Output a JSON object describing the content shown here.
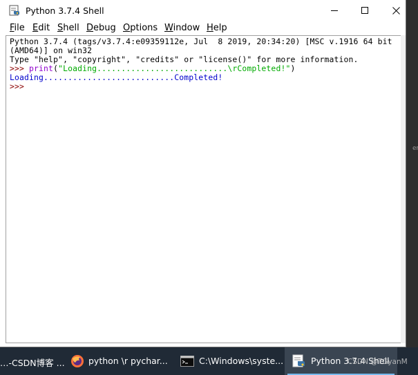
{
  "window": {
    "title": "Python 3.7.4 Shell",
    "icon": "python-idle-icon",
    "controls": [
      "minimize-icon",
      "maximize-icon",
      "close-icon"
    ]
  },
  "menu": {
    "items": [
      {
        "label": "File",
        "underline": "F",
        "rest": "ile"
      },
      {
        "label": "Edit",
        "underline": "E",
        "rest": "dit"
      },
      {
        "label": "Shell",
        "underline": "S",
        "rest": "hell"
      },
      {
        "label": "Debug",
        "underline": "D",
        "rest": "ebug"
      },
      {
        "label": "Options",
        "underline": "O",
        "rest": "ptions"
      },
      {
        "label": "Window",
        "underline": "W",
        "rest": "indow"
      },
      {
        "label": "Help",
        "underline": "H",
        "rest": "elp"
      }
    ]
  },
  "shell": {
    "banner_line1": "Python 3.7.4 (tags/v3.7.4:e09359112e, Jul  8 2019, 20:34:20) [MSC v.1916 64 bit",
    "banner_line2": "(AMD64)] on win32",
    "banner_line3": "Type \"help\", \"copyright\", \"credits\" or \"license()\" for more information.",
    "prompt": ">>> ",
    "cmd_func": "print",
    "cmd_open": "(",
    "cmd_string": "\"Loading...........................\\rCompleted!\"",
    "cmd_close": ")",
    "output": "Loading...........................Completed!",
    "prompt_empty": ">>>"
  },
  "background": {
    "fragment": "er"
  },
  "taskbar": {
    "items": [
      {
        "label": "…-CSDN博客 ...",
        "icon": "browser-tab-fragment"
      },
      {
        "label": "python \\r pychar...",
        "icon": "firefox-icon"
      },
      {
        "label": "C:\\Windows\\syste...",
        "icon": "cmd-icon"
      },
      {
        "label": "Python 3.7.4 Shell",
        "icon": "python-idle-icon",
        "active": true
      }
    ]
  },
  "watermark": "CSDN @TGyanM",
  "colors": {
    "prompt": "#8b0000",
    "builtin": "#8f00cc",
    "string": "#00aa00",
    "output": "#0000cc",
    "taskbar": "#202a36",
    "taskbar_active": "#3a4552",
    "taskbar_underline": "#76b9ed"
  }
}
